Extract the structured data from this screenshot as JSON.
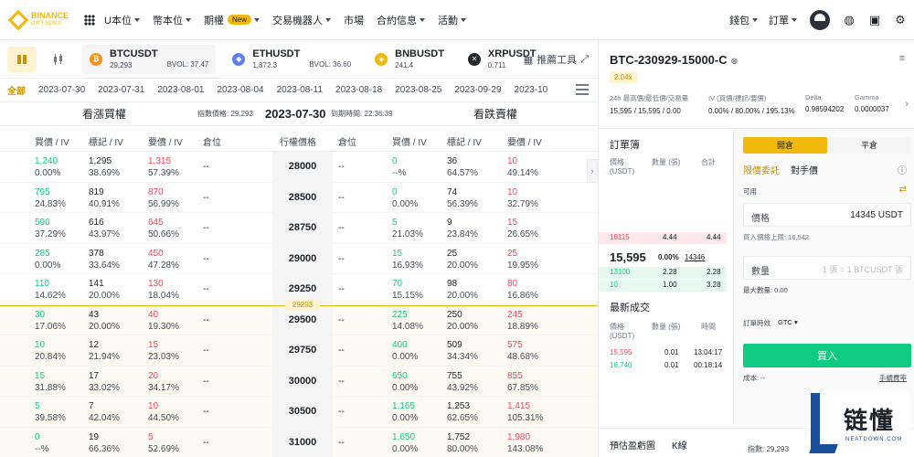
{
  "nav": {
    "logo_text": "BINANCE",
    "logo_sub": "OPTIONS",
    "menu": [
      {
        "label": "U本位",
        "caret": true
      },
      {
        "label": "幣本位",
        "caret": true
      },
      {
        "label": "期權",
        "badge": "New",
        "caret": true
      },
      {
        "label": "交易機器人",
        "caret": true
      },
      {
        "label": "市場",
        "caret": false
      },
      {
        "label": "合約信息",
        "caret": true
      },
      {
        "label": "活動",
        "caret": true
      }
    ],
    "right": {
      "wallet": "錢包",
      "orders": "訂單"
    }
  },
  "symbols": [
    {
      "name": "BTCUSDT",
      "price": "29,293",
      "bvol": "BVOL: 37.47",
      "color": "#f7931a",
      "glyph": "₿",
      "active": true
    },
    {
      "name": "ETHUSDT",
      "price": "1,872.3",
      "bvol": "BVOL: 36.60",
      "color": "#627eea",
      "glyph": "◆",
      "active": false
    },
    {
      "name": "BNBUSDT",
      "price": "241.4",
      "bvol": "",
      "color": "#f0b90b",
      "glyph": "◈",
      "active": false
    },
    {
      "name": "XRPUSDT",
      "price": "0.711",
      "bvol": "",
      "color": "#23292f",
      "glyph": "✕",
      "active": false
    }
  ],
  "tool_label": "推薦工具",
  "dates": {
    "all": "全部",
    "items": [
      "2023-07-30",
      "2023-07-31",
      "2023-08-01",
      "2023-08-04",
      "2023-08-11",
      "2023-08-18",
      "2023-08-25",
      "2023-09-29",
      "2023-10"
    ]
  },
  "header": {
    "call_title": "看漲買權",
    "put_title": "看跌賣權",
    "index_label": "指數價格: 29,293",
    "date": "2023-07-30",
    "expiry_label": "到期時間: 22:36:39"
  },
  "columns": {
    "bid": "買價 / IV",
    "mark": "標記 / IV",
    "ask": "要價 / IV",
    "pos": "倉位",
    "strike": "行權價格"
  },
  "index_marker": "29293",
  "rows": [
    {
      "strike": "28000",
      "c": {
        "bid": [
          "1,240",
          "0.00%"
        ],
        "mark": [
          "1,295",
          "38.69%"
        ],
        "ask": [
          "1,315",
          "57.39%"
        ],
        "pos": "--"
      },
      "p": {
        "bid": [
          "0",
          "--%"
        ],
        "mark": [
          "36",
          "64.57%"
        ],
        "ask": [
          "10",
          "49.14%"
        ],
        "pos": "--"
      }
    },
    {
      "strike": "28500",
      "c": {
        "bid": [
          "795",
          "24.83%"
        ],
        "mark": [
          "819",
          "40.91%"
        ],
        "ask": [
          "870",
          "56.99%"
        ],
        "pos": "--"
      },
      "p": {
        "bid": [
          "0",
          "0.00%"
        ],
        "mark": [
          "74",
          "56.39%"
        ],
        "ask": [
          "10",
          "32.79%"
        ],
        "pos": "--"
      }
    },
    {
      "strike": "28750",
      "c": {
        "bid": [
          "590",
          "37.29%"
        ],
        "mark": [
          "616",
          "43.97%"
        ],
        "ask": [
          "645",
          "50.66%"
        ],
        "pos": "--"
      },
      "p": {
        "bid": [
          "5",
          "21.03%"
        ],
        "mark": [
          "9",
          "23.84%"
        ],
        "ask": [
          "15",
          "26.65%"
        ],
        "pos": "--"
      }
    },
    {
      "strike": "29000",
      "c": {
        "bid": [
          "285",
          "0.00%"
        ],
        "mark": [
          "378",
          "33.64%"
        ],
        "ask": [
          "450",
          "47.28%"
        ],
        "pos": "--"
      },
      "p": {
        "bid": [
          "15",
          "16.93%"
        ],
        "mark": [
          "25",
          "20.00%"
        ],
        "ask": [
          "25",
          "19.95%"
        ],
        "pos": "--"
      }
    },
    {
      "strike": "29250",
      "c": {
        "bid": [
          "110",
          "14.62%"
        ],
        "mark": [
          "141",
          "20.00%"
        ],
        "ask": [
          "130",
          "18.04%"
        ],
        "pos": "--"
      },
      "p": {
        "bid": [
          "70",
          "15.15%"
        ],
        "mark": [
          "98",
          "20.00%"
        ],
        "ask": [
          "80",
          "16.86%"
        ],
        "pos": "--"
      }
    },
    {
      "strike": "29500",
      "c": {
        "bid": [
          "30",
          "17.06%"
        ],
        "mark": [
          "43",
          "20.00%"
        ],
        "ask": [
          "40",
          "19.30%"
        ],
        "pos": "--"
      },
      "p": {
        "bid": [
          "225",
          "14.08%"
        ],
        "mark": [
          "250",
          "20.00%"
        ],
        "ask": [
          "245",
          "18.89%"
        ],
        "pos": "--"
      }
    },
    {
      "strike": "29750",
      "c": {
        "bid": [
          "10",
          "20.84%"
        ],
        "mark": [
          "12",
          "21.94%"
        ],
        "ask": [
          "15",
          "23.03%"
        ],
        "pos": "--"
      },
      "p": {
        "bid": [
          "400",
          "0.00%"
        ],
        "mark": [
          "509",
          "34.34%"
        ],
        "ask": [
          "575",
          "48.68%"
        ],
        "pos": "--"
      }
    },
    {
      "strike": "30000",
      "c": {
        "bid": [
          "15",
          "31.88%"
        ],
        "mark": [
          "17",
          "33.02%"
        ],
        "ask": [
          "20",
          "34.17%"
        ],
        "pos": "--"
      },
      "p": {
        "bid": [
          "650",
          "0.00%"
        ],
        "mark": [
          "755",
          "43.92%"
        ],
        "ask": [
          "855",
          "67.85%"
        ],
        "pos": "--"
      }
    },
    {
      "strike": "30500",
      "c": {
        "bid": [
          "5",
          "39.58%"
        ],
        "mark": [
          "7",
          "42.04%"
        ],
        "ask": [
          "10",
          "44.50%"
        ],
        "pos": "--"
      },
      "p": {
        "bid": [
          "1,165",
          "0.00%"
        ],
        "mark": [
          "1,253",
          "62.65%"
        ],
        "ask": [
          "1,415",
          "105.31%"
        ],
        "pos": "--"
      }
    },
    {
      "strike": "31000",
      "c": {
        "bid": [
          "0",
          "--%"
        ],
        "mark": [
          "19",
          "66.36%"
        ],
        "ask": [
          "5",
          "52.69%"
        ],
        "pos": "--"
      },
      "p": {
        "bid": [
          "1,650",
          "0.00%"
        ],
        "mark": [
          "1,752",
          "80.00%"
        ],
        "ask": [
          "1,980",
          "143.08%"
        ],
        "pos": "--"
      }
    }
  ],
  "detail": {
    "name": "BTC-230929-15000-C",
    "leverage": "2.04x",
    "stats": [
      {
        "label": "24h 最高價/最低價/交易量",
        "value": "15,595 / 15,595 / 0.00"
      },
      {
        "label": "IV (買價/標記/要價)",
        "value": "0.00% / 80.00% / 195.13%"
      },
      {
        "label": "Delta",
        "value": "0.98594202"
      },
      {
        "label": "Gamma",
        "value": "0.0000037"
      }
    ]
  },
  "orderbook": {
    "title": "訂單簿",
    "h_price": "價格",
    "h_unit": "(USDT)",
    "h_qty": "數量 (張)",
    "h_total": "合計",
    "asks": [
      {
        "price": "16115",
        "qty": "4.44",
        "total": "4.44"
      }
    ],
    "last": "15,595",
    "last_pct": "0.00%",
    "last_mark": "14346",
    "bids": [
      {
        "price": "13100",
        "qty": "2.28",
        "total": "2.28"
      },
      {
        "price": "10",
        "qty": "1.00",
        "total": "3.28"
      }
    ],
    "trades_title": "最新成交",
    "t_price": "價格",
    "t_unit": "(USDT)",
    "t_qty": "數量 (張)",
    "t_time": "時間",
    "trades": [
      {
        "price": "15,595",
        "qty": "0.01",
        "time": "13:04:17"
      },
      {
        "price": "16,740",
        "qty": "0.01",
        "time": "00:18:14"
      }
    ]
  },
  "trade": {
    "tab_open": "開倉",
    "tab_close": "平倉",
    "limit": "限價委託",
    "counter": "對手價",
    "available": "可用",
    "price_label": "價格",
    "price_value": "14345 USDT",
    "buy_limit": "買入價格上限: 16,542",
    "qty_label": "數量",
    "qty_placeholder": "1 張 = 1 BTCUSDT 張",
    "max_qty": "最大數量: 0.00",
    "tif_label": "訂單時效",
    "tif_value": "GTC",
    "buy": "買入",
    "cost": "成本: --",
    "fee": "手續費率"
  },
  "chart_tabs": {
    "est": "預估盈虧圖",
    "k": "K線"
  },
  "ref_label": "指數: 29,293",
  "brand": {
    "cn": "链懂",
    "en": "NEATDOWN.COM"
  }
}
